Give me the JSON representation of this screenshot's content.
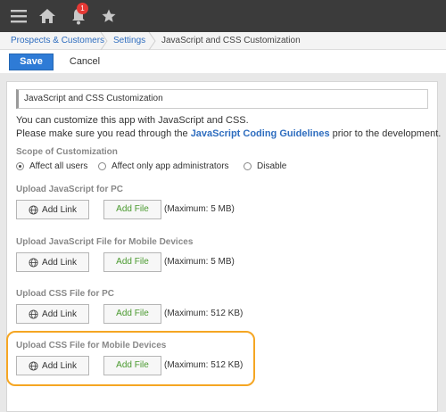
{
  "topbar": {
    "menu_icon": "hamburger-menu-icon",
    "home_icon": "home-icon",
    "bell_icon": "bell-icon",
    "star_icon": "star-icon",
    "notification_count": "1",
    "colors": {
      "bar": "#3b3b3b",
      "icon": "#c8c8c8",
      "badge": "#e53935"
    }
  },
  "breadcrumb": {
    "items": [
      "Prospects & Customers",
      "Settings",
      "JavaScript and CSS Customization"
    ]
  },
  "toolbar": {
    "save_label": "Save",
    "cancel_label": "Cancel",
    "save_color": "#2e7bd6"
  },
  "panel": {
    "title": "JavaScript and CSS Customization",
    "intro_line1": "You can customize this app with JavaScript and CSS.",
    "intro_line2_prefix": "Please make sure you read through the ",
    "intro_line2_link": "JavaScript Coding Guidelines",
    "intro_line2_suffix": " prior to the development."
  },
  "scope": {
    "title": "Scope of Customization",
    "options": [
      {
        "label": "Affect all users",
        "checked": true
      },
      {
        "label": "Affect only app administrators",
        "checked": false
      },
      {
        "label": "Disable",
        "checked": false
      }
    ]
  },
  "uploads": [
    {
      "title": "Upload JavaScript for PC",
      "add_link": "Add Link",
      "add_file": "Add File",
      "max": "(Maximum: 5 MB)"
    },
    {
      "title": "Upload JavaScript File for Mobile Devices",
      "add_link": "Add Link",
      "add_file": "Add File",
      "max": "(Maximum: 5 MB)"
    },
    {
      "title": "Upload CSS File for PC",
      "add_link": "Add Link",
      "add_file": "Add File",
      "max": "(Maximum: 512 KB)"
    },
    {
      "title": "Upload CSS File for Mobile Devices",
      "add_link": "Add Link",
      "add_file": "Add File",
      "max": "(Maximum: 512 KB)",
      "highlighted": true
    }
  ],
  "highlight_color": "#f5a623"
}
